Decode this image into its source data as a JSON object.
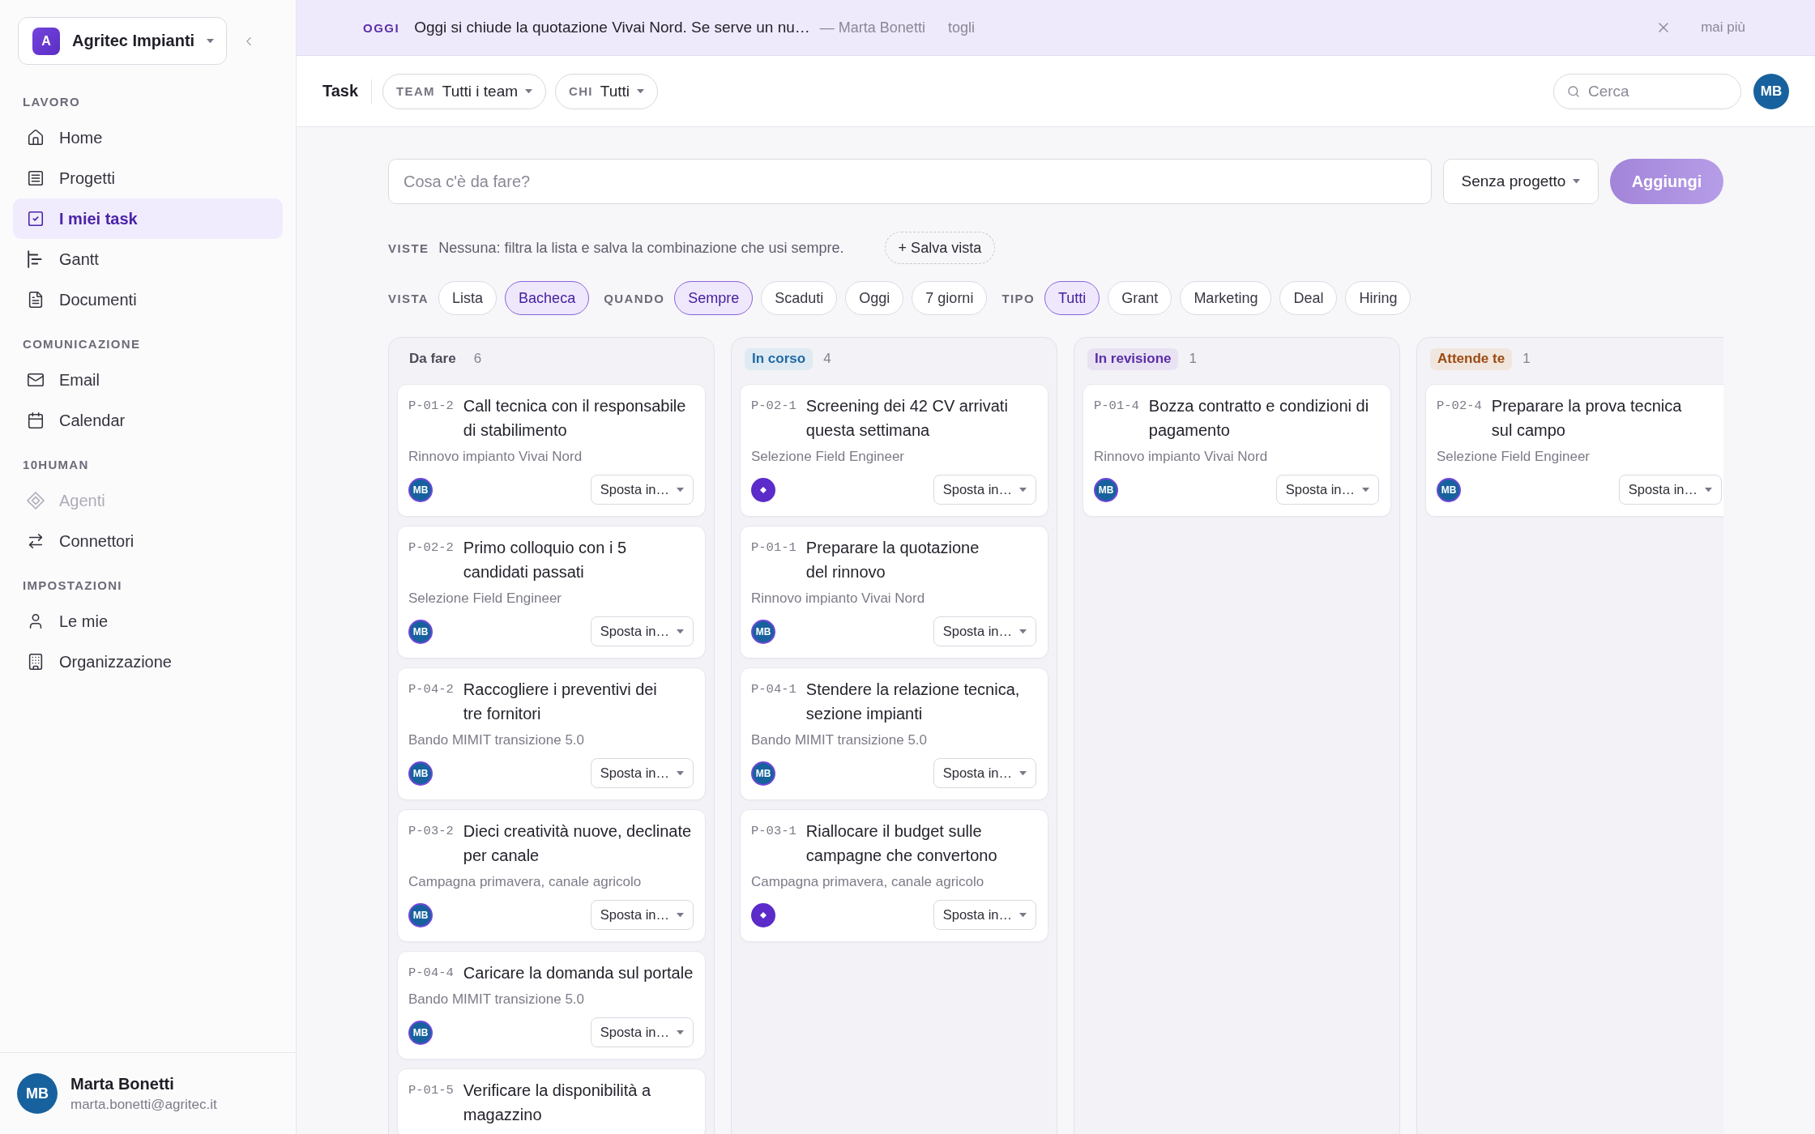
{
  "workspace": {
    "initial": "A",
    "name": "Agritec Impianti"
  },
  "sidebar": {
    "sections": [
      {
        "title": "LAVORO",
        "items": [
          {
            "label": "Home",
            "selected": false,
            "disabled": false
          },
          {
            "label": "Progetti",
            "selected": false,
            "disabled": false
          },
          {
            "label": "I miei task",
            "selected": true,
            "disabled": false
          },
          {
            "label": "Gantt",
            "selected": false,
            "disabled": false
          },
          {
            "label": "Documenti",
            "selected": false,
            "disabled": false
          }
        ]
      },
      {
        "title": "COMUNICAZIONE",
        "items": [
          {
            "label": "Email",
            "selected": false,
            "disabled": false
          },
          {
            "label": "Calendar",
            "selected": false,
            "disabled": false
          }
        ]
      },
      {
        "title": "10HUMAN",
        "items": [
          {
            "label": "Agenti",
            "selected": false,
            "disabled": true
          },
          {
            "label": "Connettori",
            "selected": false,
            "disabled": false
          }
        ]
      },
      {
        "title": "IMPOSTAZIONI",
        "items": [
          {
            "label": "Le mie",
            "selected": false,
            "disabled": false
          },
          {
            "label": "Organizzazione",
            "selected": false,
            "disabled": false
          }
        ]
      }
    ]
  },
  "user": {
    "initials": "MB",
    "name": "Marta Bonetti",
    "email": "marta.bonetti@agritec.it"
  },
  "banner": {
    "tag": "OGGI",
    "message": "Oggi si chiude la quotazione Vivai Nord. Se serve un nu…",
    "author": "— Marta Bonetti",
    "dismiss": "togli",
    "mute": "mai più"
  },
  "header": {
    "title": "Task",
    "filters": [
      {
        "label": "TEAM",
        "value": "Tutti i team"
      },
      {
        "label": "CHI",
        "value": "Tutti"
      }
    ],
    "search": {
      "placeholder": "Cerca"
    },
    "avatar": "MB"
  },
  "composer": {
    "placeholder": "Cosa c'è da fare?",
    "project": "Senza progetto",
    "submit": "Aggiungi"
  },
  "views": {
    "label": "VISTE",
    "hint": "Nessuna: filtra la lista e salva la combinazione che usi sempre.",
    "save": "+ Salva vista"
  },
  "filter_groups": [
    {
      "label": "VISTA",
      "options": [
        {
          "label": "Lista",
          "selected": false
        },
        {
          "label": "Bacheca",
          "selected": true
        }
      ]
    },
    {
      "label": "QUANDO",
      "options": [
        {
          "label": "Sempre",
          "selected": true
        },
        {
          "label": "Scaduti",
          "selected": false
        },
        {
          "label": "Oggi",
          "selected": false
        },
        {
          "label": "7 giorni",
          "selected": false
        }
      ]
    },
    {
      "label": "TIPO",
      "options": [
        {
          "label": "Tutti",
          "selected": true
        },
        {
          "label": "Grant",
          "selected": false
        },
        {
          "label": "Marketing",
          "selected": false
        },
        {
          "label": "Deal",
          "selected": false
        },
        {
          "label": "Hiring",
          "selected": false
        }
      ]
    }
  ],
  "columns": [
    {
      "title": "Da fare",
      "kind": "plain",
      "color": "#4d4b58",
      "count": "6",
      "cards": [
        {
          "id": "P-01-2",
          "title": "Call tecnica con il responsabile di stabilimento",
          "project": "Rinnovo impianto Vivai Nord",
          "assignee": {
            "kind": "person",
            "initials": "MB"
          },
          "move": "Sposta in…"
        },
        {
          "id": "P-02-2",
          "title": "Primo colloquio con i 5 candidati passati",
          "project": "Selezione Field Engineer",
          "assignee": {
            "kind": "person",
            "initials": "MB"
          },
          "move": "Sposta in…"
        },
        {
          "id": "P-04-2",
          "title": "Raccogliere i preventivi dei tre fornitori",
          "project": "Bando MIMIT transizione 5.0",
          "assignee": {
            "kind": "person",
            "initials": "MB"
          },
          "move": "Sposta in…"
        },
        {
          "id": "P-03-2",
          "title": "Dieci creatività nuove, declinate per canale",
          "project": "Campagna primavera, canale agricolo",
          "assignee": {
            "kind": "person",
            "initials": "MB"
          },
          "move": "Sposta in…"
        },
        {
          "id": "P-04-4",
          "title": "Caricare la domanda sul portale",
          "project": "Bando MIMIT transizione 5.0",
          "assignee": {
            "kind": "person",
            "initials": "MB"
          },
          "move": "Sposta in…"
        },
        {
          "id": "P-01-5",
          "title": "Verificare la disponibilità a magazzino"
        }
      ]
    },
    {
      "title": "In corso",
      "kind": "badge",
      "color": "#1f6aa5",
      "count": "4",
      "cards": [
        {
          "id": "P-02-1",
          "title": "Screening dei 42 CV arrivati questa settimana",
          "project": "Selezione Field Engineer",
          "assignee": {
            "kind": "agent"
          },
          "move": "Sposta in…"
        },
        {
          "id": "P-01-1",
          "title": "Preparare la quotazione del rinnovo",
          "project": "Rinnovo impianto Vivai Nord",
          "assignee": {
            "kind": "person",
            "initials": "MB"
          },
          "move": "Sposta in…"
        },
        {
          "id": "P-04-1",
          "title": "Stendere la relazione tecnica, sezione impianti",
          "project": "Bando MIMIT transizione 5.0",
          "assignee": {
            "kind": "person",
            "initials": "MB"
          },
          "move": "Sposta in…"
        },
        {
          "id": "P-03-1",
          "title": "Riallocare il budget sulle campagne che convertono",
          "project": "Campagna primavera, canale agricolo",
          "assignee": {
            "kind": "agent"
          },
          "move": "Sposta in…"
        }
      ]
    },
    {
      "title": "In revisione",
      "kind": "badge",
      "color": "#5a2ea6",
      "count": "1",
      "cards": [
        {
          "id": "P-01-4",
          "title": "Bozza contratto e condizioni di pagamento",
          "project": "Rinnovo impianto Vivai Nord",
          "assignee": {
            "kind": "person",
            "initials": "MB"
          },
          "move": "Sposta in…"
        }
      ]
    },
    {
      "title": "Attende te",
      "kind": "badge",
      "color": "#9b4a12",
      "count": "1",
      "cards": [
        {
          "id": "P-02-4",
          "title": "Preparare la prova tecnica sul campo",
          "project": "Selezione Field Engineer",
          "assignee": {
            "kind": "person",
            "initials": "MB"
          },
          "move": "Sposta in…"
        }
      ]
    }
  ]
}
